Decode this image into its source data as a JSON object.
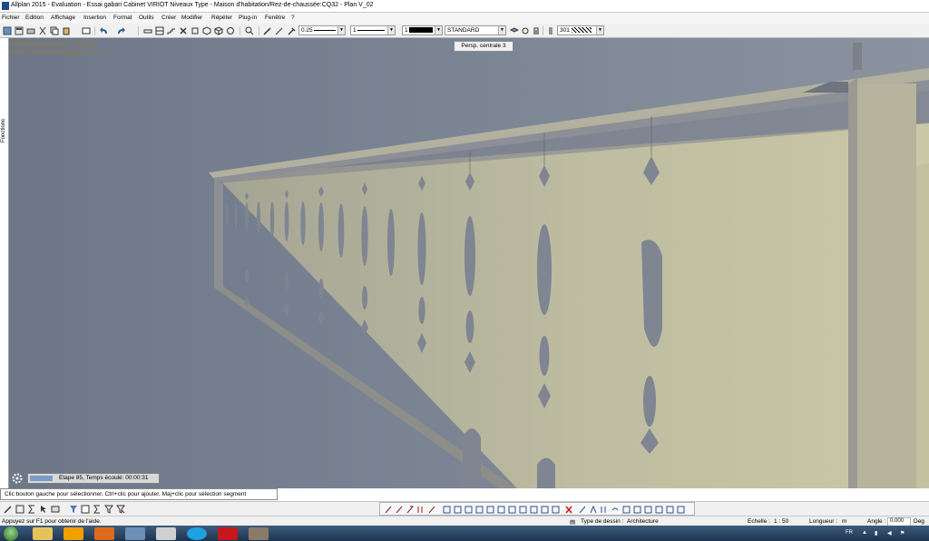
{
  "window": {
    "title": "Allplan 2015 - Evaluation - Essai gabari Cabinet VIRIOT Niveaux Type - Maison d'habitation/Rez-de-chaussée:CQ32 - Plan V_02"
  },
  "menu": [
    "Fichier",
    "Edition",
    "Affichage",
    "Insertion",
    "Format",
    "Outils",
    "Créer",
    "Modifier",
    "Répéter",
    "Plug-in",
    "Fenêtre",
    "?"
  ],
  "toolbar": {
    "pen_thickness": "0.25",
    "line_type": "1",
    "color": "1",
    "layer": "STANDARD",
    "format_number": "301"
  },
  "left_panel": {
    "label": "Fonctions"
  },
  "viewport": {
    "rtoi_elapsed": "RTOI Elapsed time : 00:00:31",
    "rtoi_update": "RTOI Time to next update : 1.3 s",
    "view_tooltip": "Persp. centrale 3",
    "progress_text": "Etape 85, Temps écoulé: 00:00:31",
    "progress_fraction": 0.18
  },
  "prompt": {
    "text": "Clic bouton gauche pour sélectionner, Ctrl+clic pour ajouter, Maj+clic pour sélection segment"
  },
  "status": {
    "help": "Appuyez sur F1 pour obtenir de l'aide.",
    "drawing_type_label": "Type de dessin :",
    "drawing_type_value": "Architecture",
    "scale_label": "Echelle :",
    "scale_value": "1 : 50",
    "length_label": "Longueur :",
    "length_value": "m",
    "angle_label": "Angle :",
    "angle_value": "0.000",
    "angle_unit": "Deg"
  },
  "tray": {
    "lang": "FR"
  },
  "colors": {
    "sky": "#7a8494",
    "wall": "#c7c5a6",
    "wall_shadow": "#8f9097",
    "cap": "#a7a797",
    "accent": "#1d4a8c"
  }
}
